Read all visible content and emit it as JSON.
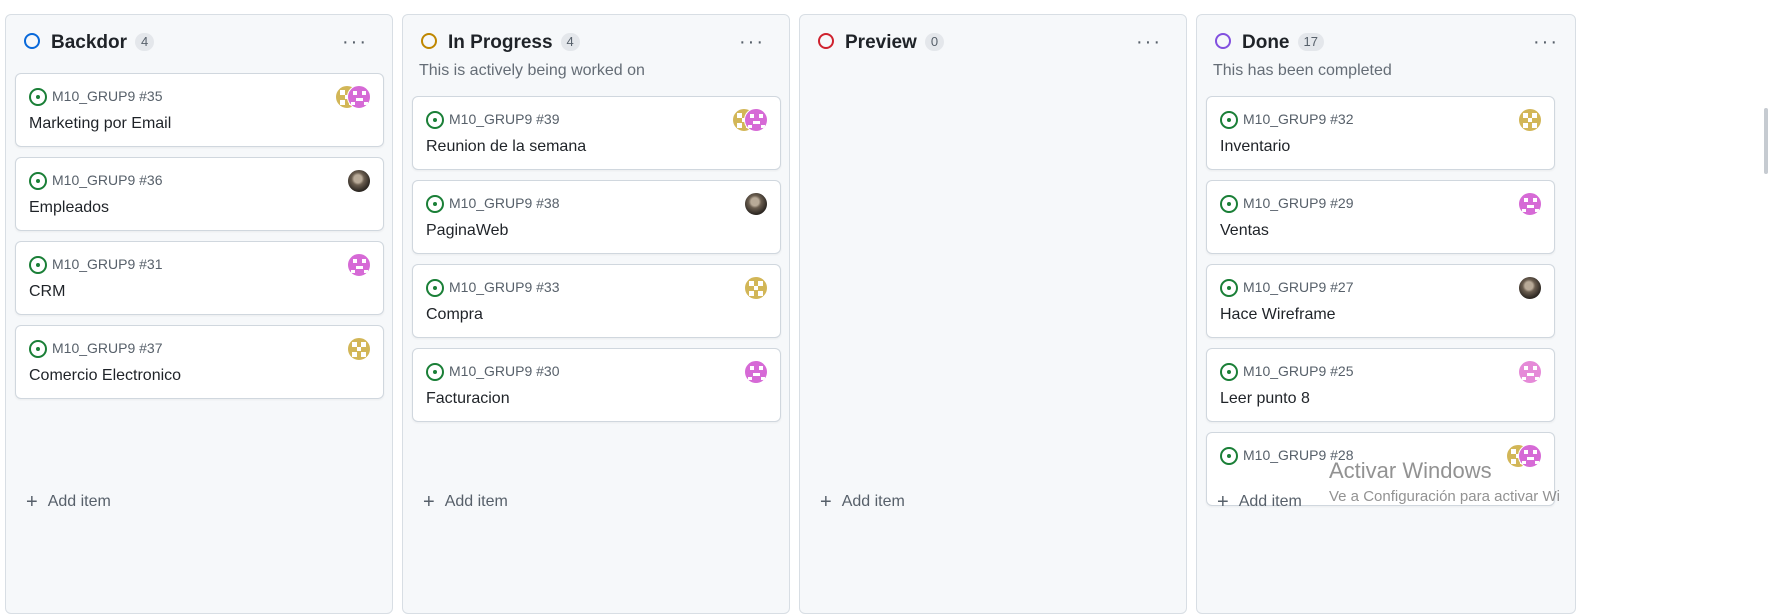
{
  "columns": [
    {
      "title": "Backdor",
      "count": "4",
      "description": "",
      "status_color": "#0969da",
      "menu_label": "···",
      "add_label": "Add item",
      "cards": [
        {
          "ref": "M10_GRUP9 #35",
          "title": "Marketing por Email",
          "assignees": [
            "gold",
            "pink"
          ]
        },
        {
          "ref": "M10_GRUP9 #36",
          "title": "Empleados",
          "assignees": [
            "photo"
          ]
        },
        {
          "ref": "M10_GRUP9 #31",
          "title": "CRM",
          "assignees": [
            "pink"
          ]
        },
        {
          "ref": "M10_GRUP9 #37",
          "title": "Comercio Electronico",
          "assignees": [
            "gold"
          ]
        }
      ]
    },
    {
      "title": "In Progress",
      "count": "4",
      "description": "This is actively being worked on",
      "status_color": "#bf8700",
      "menu_label": "···",
      "add_label": "Add item",
      "cards": [
        {
          "ref": "M10_GRUP9 #39",
          "title": "Reunion de la semana",
          "assignees": [
            "gold",
            "pink"
          ]
        },
        {
          "ref": "M10_GRUP9 #38",
          "title": "PaginaWeb",
          "assignees": [
            "photo"
          ]
        },
        {
          "ref": "M10_GRUP9 #33",
          "title": "Compra",
          "assignees": [
            "gold"
          ]
        },
        {
          "ref": "M10_GRUP9 #30",
          "title": "Facturacion",
          "assignees": [
            "pink"
          ]
        }
      ]
    },
    {
      "title": "Preview",
      "count": "0",
      "description": "",
      "status_color": "#cf222e",
      "menu_label": "···",
      "add_label": "Add item",
      "cards": []
    },
    {
      "title": "Done",
      "count": "17",
      "description": "This has been completed",
      "status_color": "#8250df",
      "menu_label": "···",
      "add_label": "Add item",
      "cards": [
        {
          "ref": "M10_GRUP9 #32",
          "title": "Inventario",
          "assignees": [
            "gold"
          ]
        },
        {
          "ref": "M10_GRUP9 #29",
          "title": "Ventas",
          "assignees": [
            "pink"
          ]
        },
        {
          "ref": "M10_GRUP9 #27",
          "title": "Hace Wireframe",
          "assignees": [
            "photo"
          ]
        },
        {
          "ref": "M10_GRUP9 #25",
          "title": "Leer punto 8",
          "assignees": [
            "pink-light"
          ]
        },
        {
          "ref": "M10_GRUP9 #28",
          "title": "",
          "assignees": [
            "gold",
            "pink"
          ]
        }
      ]
    }
  ],
  "watermark": {
    "title": "Activar Windows",
    "subtitle": "Ve a Configuración para activar Wi"
  }
}
